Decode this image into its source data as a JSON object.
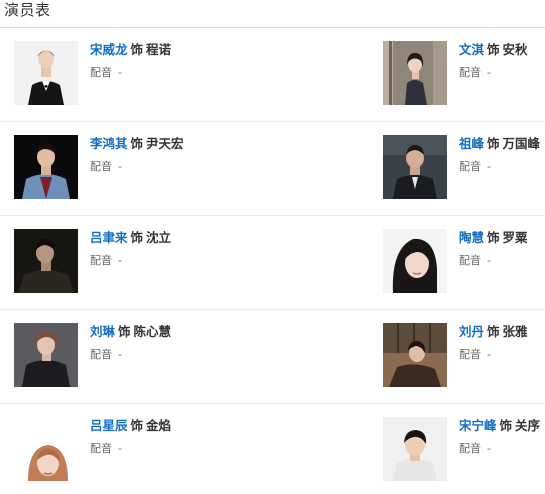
{
  "section": {
    "title": "演员表"
  },
  "labels": {
    "as": "饰",
    "dub": "配音",
    "dub_value": "-"
  },
  "cast": [
    {
      "actor": "宋威龙",
      "role": "程诺"
    },
    {
      "actor": "文淇",
      "role": "安秋"
    },
    {
      "actor": "李鸿其",
      "role": "尹天宏"
    },
    {
      "actor": "祖峰",
      "role": "万国峰"
    },
    {
      "actor": "吕聿来",
      "role": "沈立"
    },
    {
      "actor": "陶慧",
      "role": "罗粟"
    },
    {
      "actor": "刘琳",
      "role": "陈心慧"
    },
    {
      "actor": "刘丹",
      "role": "张雅"
    },
    {
      "actor": "吕星辰",
      "role": "金焰"
    },
    {
      "actor": "宋宁峰",
      "role": "关序"
    }
  ],
  "colors": {
    "actor_link": "#136ec2",
    "divider": "#eeeeee"
  }
}
